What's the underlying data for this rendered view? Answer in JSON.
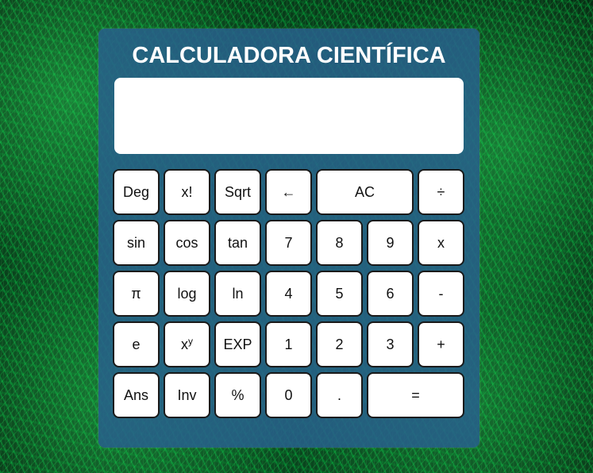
{
  "title": "CALCULADORA CIENTÍFICA",
  "display": {
    "value": ""
  },
  "keys": {
    "deg": "Deg",
    "factorial": "x!",
    "sqrt": "Sqrt",
    "backspace": "←",
    "ac": "AC",
    "divide": "÷",
    "sin": "sin",
    "cos": "cos",
    "tan": "tan",
    "seven": "7",
    "eight": "8",
    "nine": "9",
    "multiply": "x",
    "pi": "π",
    "log": "log",
    "ln": "ln",
    "four": "4",
    "five": "5",
    "six": "6",
    "minus": "-",
    "e": "e",
    "power_base": "x",
    "power_exp": "y",
    "exp": "EXP",
    "one": "1",
    "two": "2",
    "three": "3",
    "plus": "+",
    "ans": "Ans",
    "inv": "Inv",
    "percent": "%",
    "zero": "0",
    "dot": ".",
    "equals": "="
  },
  "colors": {
    "panel": "#285f8c",
    "key_background": "#ffffff",
    "key_border": "#1a1a1a",
    "title_text": "#ffffff",
    "background_accent": "#0d6b2c"
  }
}
